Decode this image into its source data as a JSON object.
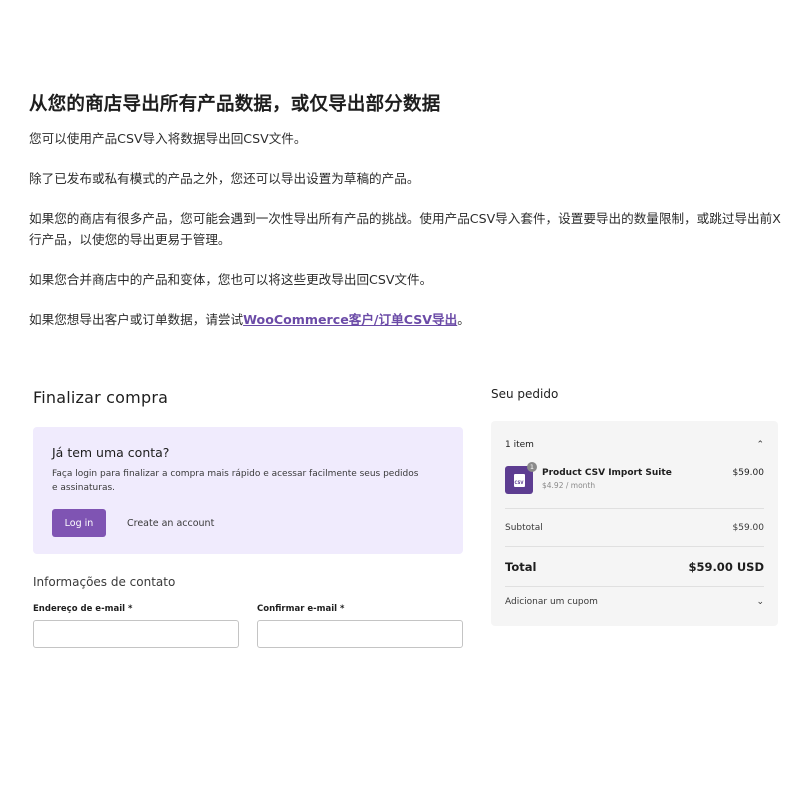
{
  "intro": {
    "heading": "从您的商店导出所有产品数据，或仅导出部分数据",
    "p1": "您可以使用产品CSV导入将数据导出回CSV文件。",
    "p2": "除了已发布或私有模式的产品之外，您还可以导出设置为草稿的产品。",
    "p3": "如果您的商店有很多产品，您可能会遇到一次性导出所有产品的挑战。使用产品CSV导入套件，设置要导出的数量限制，或跳过导出前X行产品，以使您的导出更易于管理。",
    "p4": "如果您合并商店中的产品和变体，您也可以将这些更改导出回CSV文件。",
    "p5_prefix": "如果您想导出客户或订单数据，请尝试",
    "p5_link": "WooCommerce客户/订单CSV导出",
    "p5_suffix": "。"
  },
  "checkout": {
    "title": "Finalizar compra",
    "account_question": "Já tem uma conta?",
    "account_desc": "Faça login para finalizar a compra mais rápido e acessar facilmente seus pedidos e assinaturas.",
    "login_label": "Log in",
    "create_account_label": "Create an account",
    "contact_title": "Informações de contato",
    "email_label": "Endereço de e-mail *",
    "confirm_email_label": "Confirmar e-mail *",
    "email_value": "",
    "confirm_email_value": ""
  },
  "order": {
    "title": "Seu pedido",
    "items_count": "1 item",
    "collapse_icon": "chevron-up-icon",
    "product": {
      "name": "Product CSV Import Suite",
      "period": "$4.92 / month",
      "price": "$59.00",
      "quantity": "1",
      "thumb_text": "CSV"
    },
    "subtotal_label": "Subtotal",
    "subtotal_value": "$59.00",
    "total_label": "Total",
    "total_value": "$59.00 USD",
    "coupon_label": "Adicionar um cupom",
    "coupon_icon": "chevron-down-icon"
  },
  "colors": {
    "accent": "#7f54b3",
    "account_box_bg": "#f0ebfd",
    "order_box_bg": "#f5f5f5",
    "link": "#6b4ba7"
  }
}
